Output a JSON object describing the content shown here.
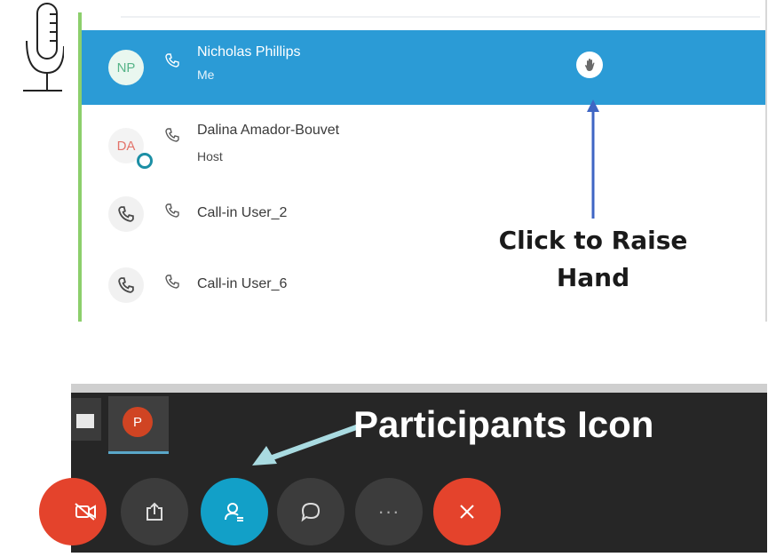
{
  "participants_panel": {
    "rows": [
      {
        "initials": "NP",
        "name": "Nicholas Phillips",
        "role": "Me"
      },
      {
        "initials": "DA",
        "name": "Dalina Amador-Bouvet",
        "role": "Host"
      },
      {
        "name": "Call-in User_2"
      },
      {
        "name": "Call-in User_6"
      }
    ]
  },
  "annotations": {
    "raise_hand": "Click to Raise Hand",
    "participants_icon": "Participants Icon"
  },
  "toolbar": {
    "buttons": [
      "video-off-icon",
      "share-icon",
      "participants-icon",
      "chat-icon",
      "more-icon",
      "leave-icon"
    ],
    "more_label": "···"
  },
  "colors": {
    "selected_row": "#2b9bd6",
    "participants_button": "#12a0c8",
    "leave_button": "#e4432c",
    "toolbar_bg": "#262626"
  }
}
